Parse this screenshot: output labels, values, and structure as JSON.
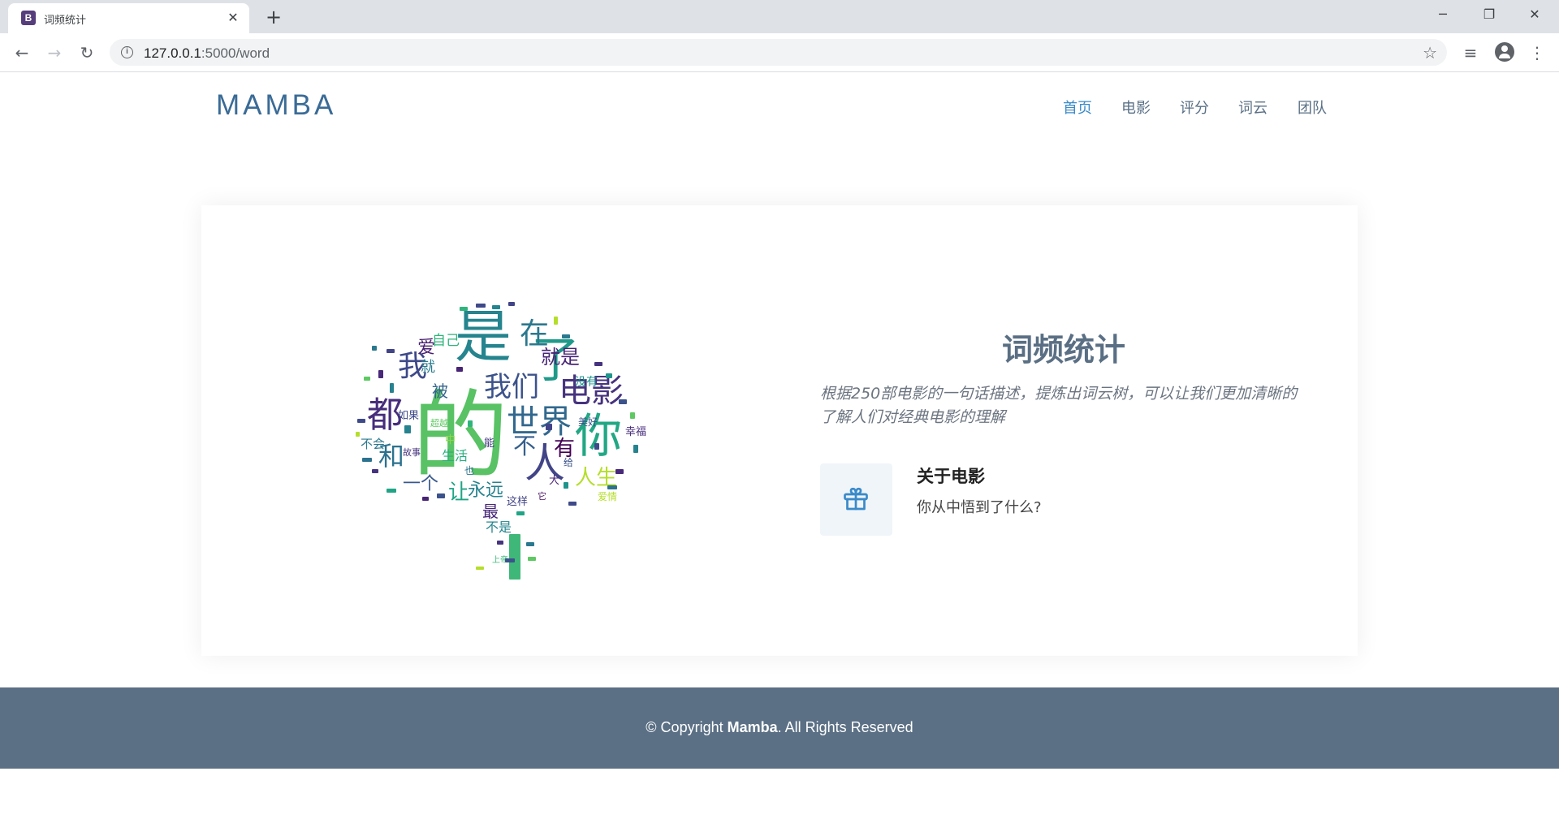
{
  "browser": {
    "tab_title": "词频统计",
    "tab_favicon_letter": "B",
    "url_host": "127.0.0.1",
    "url_path": ":5000/word",
    "new_tab_symbol": "+",
    "close_symbol": "✕",
    "minimize_symbol": "─",
    "restore_symbol": "❐",
    "window_close_symbol": "✕",
    "back_symbol": "←",
    "forward_symbol": "→",
    "reload_symbol": "↻",
    "star_symbol": "☆",
    "playlist_symbol": "≡",
    "menu_symbol": "⋮"
  },
  "header": {
    "logo": "MAMBA",
    "nav": [
      {
        "label": "首页",
        "active": true
      },
      {
        "label": "电影",
        "active": false
      },
      {
        "label": "评分",
        "active": false
      },
      {
        "label": "词云",
        "active": false
      },
      {
        "label": "团队",
        "active": false
      }
    ]
  },
  "main": {
    "title": "词频统计",
    "description": "根据250部电影的一句话描述，提炼出词云树，可以让我们更加清晰的了解人们对经典电影的理解",
    "feature": {
      "icon": "gift-icon",
      "title": "关于电影",
      "text": "你从中悟到了什么?"
    },
    "wordcloud": {
      "words": [
        "的",
        "是",
        "你",
        "了",
        "人",
        "电影",
        "世界",
        "我们",
        "都",
        "和",
        "在",
        "我",
        "就是",
        "人生",
        "有",
        "不",
        "永远",
        "一个",
        "让",
        "最",
        "被",
        "爱",
        "自己",
        "就",
        "没有",
        "生活",
        "这样",
        "不会",
        "美好",
        "幸福",
        "爱情",
        "如果",
        "超越",
        "不是",
        "上帝",
        "故事",
        "能",
        "也",
        "大",
        "中",
        "给",
        "它"
      ]
    },
    "colors": {
      "accent": "#3a8ac9",
      "title": "#5a6f84",
      "footer_bg": "#5b7085"
    }
  },
  "footer": {
    "prefix": "© Copyright ",
    "brand": "Mamba",
    "suffix": ". All Rights Reserved"
  }
}
